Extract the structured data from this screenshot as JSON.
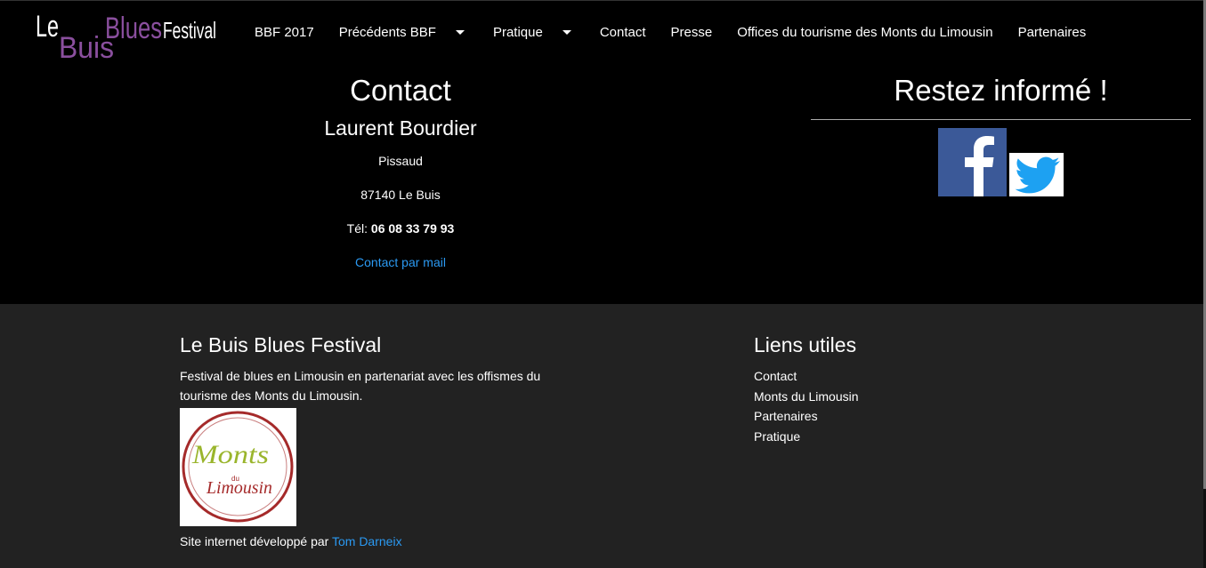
{
  "logo": {
    "le": "Le",
    "buis": "Buis",
    "blues": "Blues",
    "festival": "Festival"
  },
  "nav": {
    "items": [
      {
        "label": "BBF 2017"
      },
      {
        "label": "Précédents BBF"
      },
      {
        "label": "Pratique"
      },
      {
        "label": "Contact"
      },
      {
        "label": "Presse"
      },
      {
        "label": "Offices du tourisme des Monts du Limousin"
      },
      {
        "label": "Partenaires"
      }
    ]
  },
  "contact": {
    "title": "Contact",
    "name": "Laurent Bourdier",
    "place": "Pissaud",
    "city": "87140 Le Buis",
    "tel_label": "Tél: ",
    "tel": "06 08 33 79 93",
    "mail_link": "Contact par mail"
  },
  "info": {
    "title": "Restez informé !"
  },
  "footer": {
    "title": "Le Buis Blues Festival",
    "description": "Festival de blues en Limousin en partenariat avec les offismes du tourisme des Monts du Limousin.",
    "badge": {
      "word1": "Monts",
      "word2": "du",
      "word3": "Limousin"
    },
    "credit_prefix": "Site internet développé par ",
    "credit_name": "Tom Darneix",
    "links_title": "Liens utiles",
    "links": [
      "Contact",
      "Monts du Limousin",
      "Partenaires",
      "Pratique"
    ]
  },
  "colors": {
    "link": "#2b9af3",
    "footer_bg": "#222222",
    "logo_purple": "#8a4f9e",
    "facebook": "#3b5998",
    "twitter": "#1da1f2",
    "badge_red": "#a52a2a",
    "badge_green": "#9ab52c"
  },
  "icons": {
    "facebook": "facebook-icon",
    "twitter": "twitter-icon"
  }
}
